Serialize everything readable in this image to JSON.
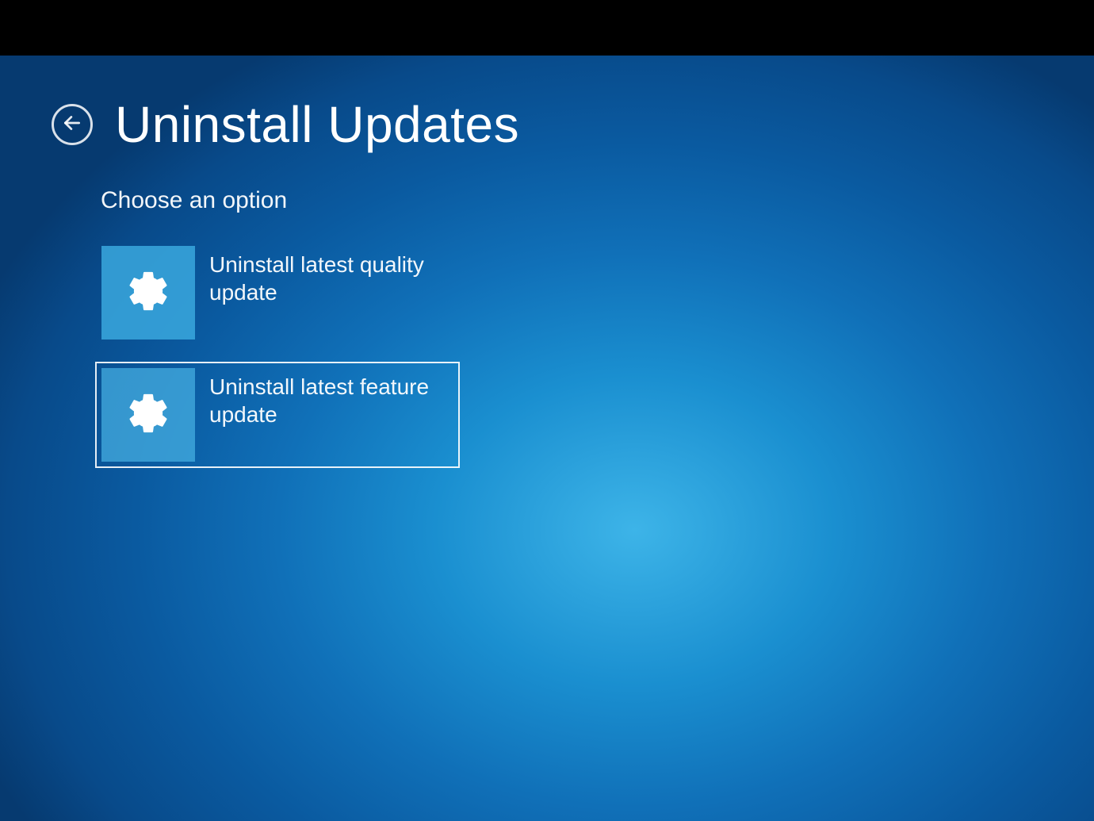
{
  "header": {
    "title": "Uninstall Updates"
  },
  "subtitle": "Choose an option",
  "options": [
    {
      "label": "Uninstall latest quality update",
      "selected": false
    },
    {
      "label": "Uninstall latest feature update",
      "selected": true
    }
  ]
}
